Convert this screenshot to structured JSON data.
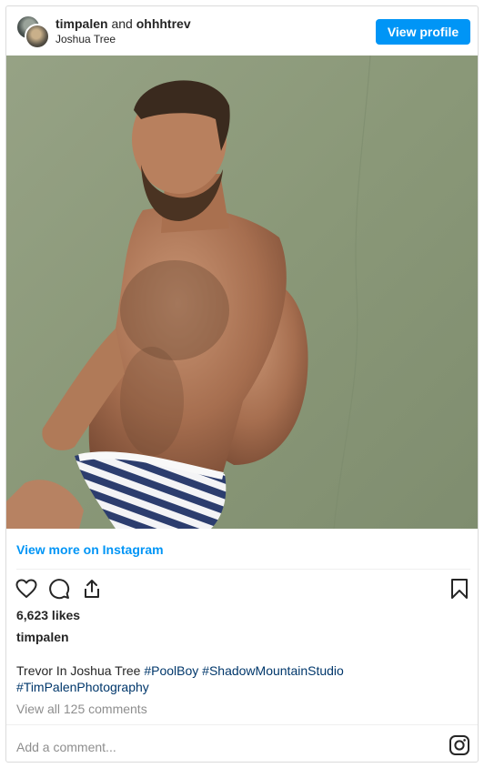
{
  "header": {
    "user1": "timpalen",
    "conjunction": " and ",
    "user2": "ohhhtrev",
    "location": "Joshua Tree",
    "view_profile_label": "View profile"
  },
  "photo": {
    "description_icon": "post-photo",
    "wall_color": "#8d9a7b"
  },
  "links": {
    "view_more": "View more on Instagram"
  },
  "actions": {
    "icons": [
      "heart-icon",
      "comment-icon",
      "share-icon",
      "bookmark-icon"
    ]
  },
  "post": {
    "likes": "6,623 likes",
    "owner": "timpalen",
    "caption_text": "Trevor In Joshua Tree ",
    "hashtags": [
      "#PoolBoy",
      "#ShadowMountainStudio",
      "#TimPalenPhotography"
    ],
    "view_comments": "View all 125 comments",
    "add_comment_placeholder": "Add a comment..."
  },
  "colors": {
    "accent": "#0095f6",
    "hashtag": "#00376b",
    "muted": "#8e8e8e"
  }
}
